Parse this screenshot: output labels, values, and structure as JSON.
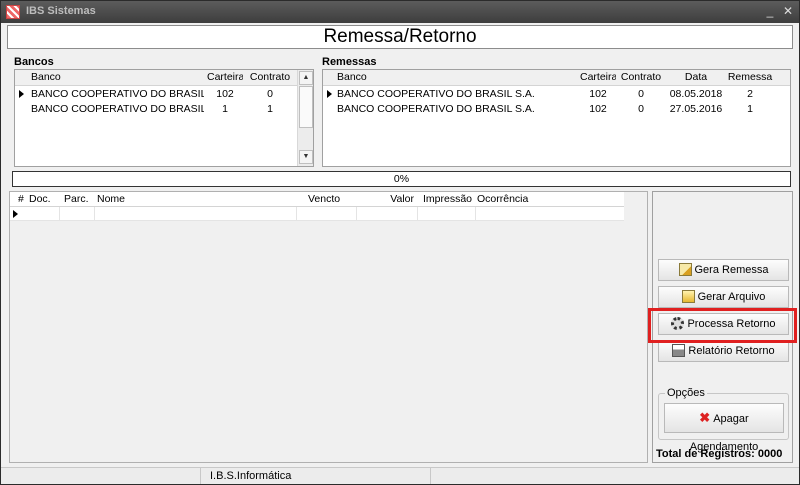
{
  "window": {
    "title": "IBS Sistemas"
  },
  "page_title": "Remessa/Retorno",
  "bancos": {
    "label": "Bancos",
    "columns": [
      "Banco",
      "Carteira",
      "Contrato"
    ],
    "rows": [
      {
        "banco": "BANCO COOPERATIVO DO BRASIL S",
        "carteira": "102",
        "contrato": "0"
      },
      {
        "banco": "BANCO COOPERATIVO DO BRASIL S",
        "carteira": "1",
        "contrato": "1"
      }
    ]
  },
  "remessas": {
    "label": "Remessas",
    "columns": [
      "Banco",
      "Carteira",
      "Contrato",
      "Data",
      "Remessa"
    ],
    "rows": [
      {
        "banco": "BANCO COOPERATIVO DO BRASIL S.A.",
        "carteira": "102",
        "contrato": "0",
        "data": "08.05.2018",
        "remessa": "2"
      },
      {
        "banco": "BANCO COOPERATIVO DO BRASIL S.A.",
        "carteira": "102",
        "contrato": "0",
        "data": "27.05.2016",
        "remessa": "1"
      }
    ]
  },
  "progress": {
    "label": "0%",
    "value": 0
  },
  "documentos": {
    "columns": [
      "#",
      "Doc.",
      "Parc.",
      "Nome",
      "Vencto",
      "Valor",
      "Impressão",
      "Ocorrência"
    ]
  },
  "actions": {
    "gera_remessa": "Gera Remessa",
    "gerar_arquivo": "Gerar Arquivo",
    "processa_retorno": "Processa Retorno",
    "relatorio_retorno": "Relatório Retorno"
  },
  "opcoes": {
    "label": "Opções",
    "apagar_agendamento": "Apagar Agendamento"
  },
  "total_registros": "Total de Registros: 0000",
  "statusbar": {
    "company": "I.B.S.Informática"
  },
  "colors": {
    "highlight": "#e02020",
    "titlebar": "#4a4a4a"
  }
}
